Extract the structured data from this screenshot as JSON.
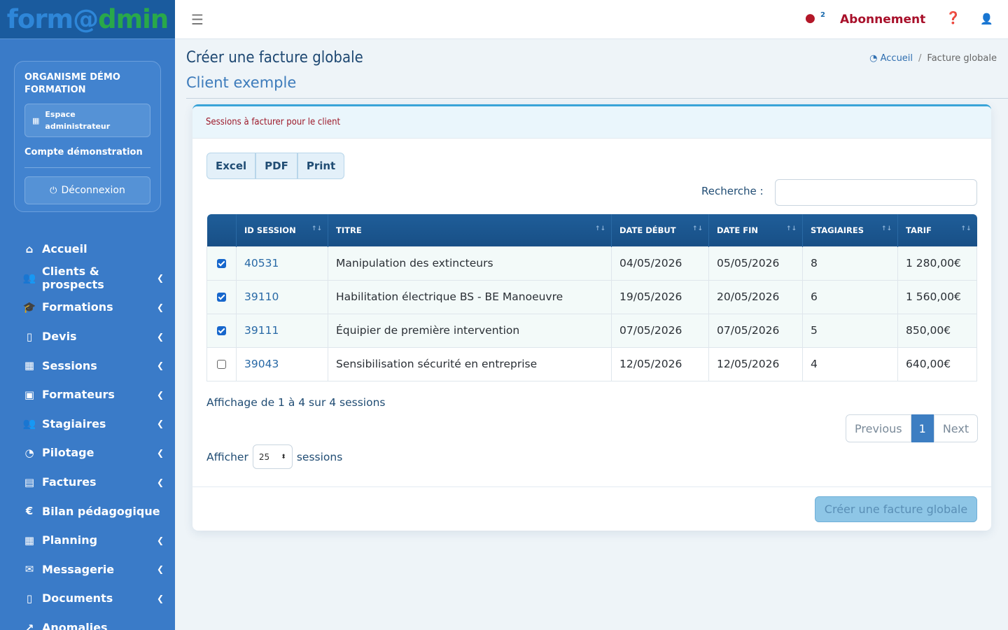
{
  "brand": {
    "part1": "form@",
    "part2": "dmin"
  },
  "org": {
    "name": "ORGANISME DÉMO FORMATION",
    "space": "Espace administrateur",
    "account": "Compte démonstration",
    "logout": "Déconnexion"
  },
  "menu": [
    {
      "label": "Accueil",
      "icon": "home-icon",
      "glyph": "⌂",
      "submenu": false
    },
    {
      "label": "Clients & prospects",
      "icon": "users-icon",
      "glyph": "👥",
      "submenu": true
    },
    {
      "label": "Formations",
      "icon": "graduation-cap-icon",
      "glyph": "🎓",
      "submenu": true
    },
    {
      "label": "Devis",
      "icon": "file-icon",
      "glyph": "▯",
      "submenu": true
    },
    {
      "label": "Sessions",
      "icon": "calendar-icon",
      "glyph": "▦",
      "submenu": true
    },
    {
      "label": "Formateurs",
      "icon": "id-card-icon",
      "glyph": "▣",
      "submenu": true
    },
    {
      "label": "Stagiaires",
      "icon": "users-icon",
      "glyph": "👥",
      "submenu": true
    },
    {
      "label": "Pilotage",
      "icon": "gauge-icon",
      "glyph": "◔",
      "submenu": true
    },
    {
      "label": "Factures",
      "icon": "invoice-icon",
      "glyph": "▤",
      "submenu": true
    },
    {
      "label": "Bilan pédagogique",
      "icon": "euro-icon",
      "glyph": "€",
      "submenu": false
    },
    {
      "label": "Planning",
      "icon": "calendar-icon",
      "glyph": "▦",
      "submenu": true
    },
    {
      "label": "Messagerie",
      "icon": "mail-icon",
      "glyph": "✉",
      "submenu": true
    },
    {
      "label": "Documents",
      "icon": "document-icon",
      "glyph": "▯",
      "submenu": true
    },
    {
      "label": "Anomalies",
      "icon": "chart-line-icon",
      "glyph": "↗",
      "submenu": false
    }
  ],
  "topbar": {
    "badge": "2",
    "subscription": "Abonnement"
  },
  "page": {
    "title": "Créer une facture globale",
    "subtitle": "Client exemple",
    "breadcrumb_home": "Accueil",
    "breadcrumb_current": "Facture globale"
  },
  "card": {
    "title": "Sessions à facturer pour le client",
    "export_buttons": [
      "Excel",
      "PDF",
      "Print"
    ],
    "search_label": "Recherche :",
    "search_value": ""
  },
  "table": {
    "columns": [
      "ID SESSION",
      "TITRE",
      "DATE DÉBUT",
      "DATE FIN",
      "STAGIAIRES",
      "TARIF"
    ],
    "rows": [
      {
        "checked": true,
        "id": "40531",
        "titre": "Manipulation des extincteurs",
        "debut": "04/05/2026",
        "fin": "05/05/2026",
        "stagiaires": "8",
        "tarif": "1 280,00€"
      },
      {
        "checked": true,
        "id": "39110",
        "titre": "Habilitation électrique BS - BE Manoeuvre",
        "debut": "19/05/2026",
        "fin": "20/05/2026",
        "stagiaires": "6",
        "tarif": "1 560,00€"
      },
      {
        "checked": true,
        "id": "39111",
        "titre": "Équipier de première intervention",
        "debut": "07/05/2026",
        "fin": "07/05/2026",
        "stagiaires": "5",
        "tarif": "850,00€"
      },
      {
        "checked": false,
        "id": "39043",
        "titre": "Sensibilisation sécurité en entreprise",
        "debut": "12/05/2026",
        "fin": "12/05/2026",
        "stagiaires": "4",
        "tarif": "640,00€"
      }
    ]
  },
  "pagination": {
    "info": "Affichage de 1 à 4 sur 4 sessions",
    "previous": "Previous",
    "current": "1",
    "next": "Next",
    "show_label": "Afficher",
    "page_size": "25",
    "show_suffix": "sessions"
  },
  "footer": {
    "create_button": "Créer une facture globale"
  },
  "colors": {
    "sidebar": "#3a7bc8",
    "accent_red": "#a8102a",
    "table_header": "#1f5e99",
    "brand_green": "#29a84a"
  }
}
